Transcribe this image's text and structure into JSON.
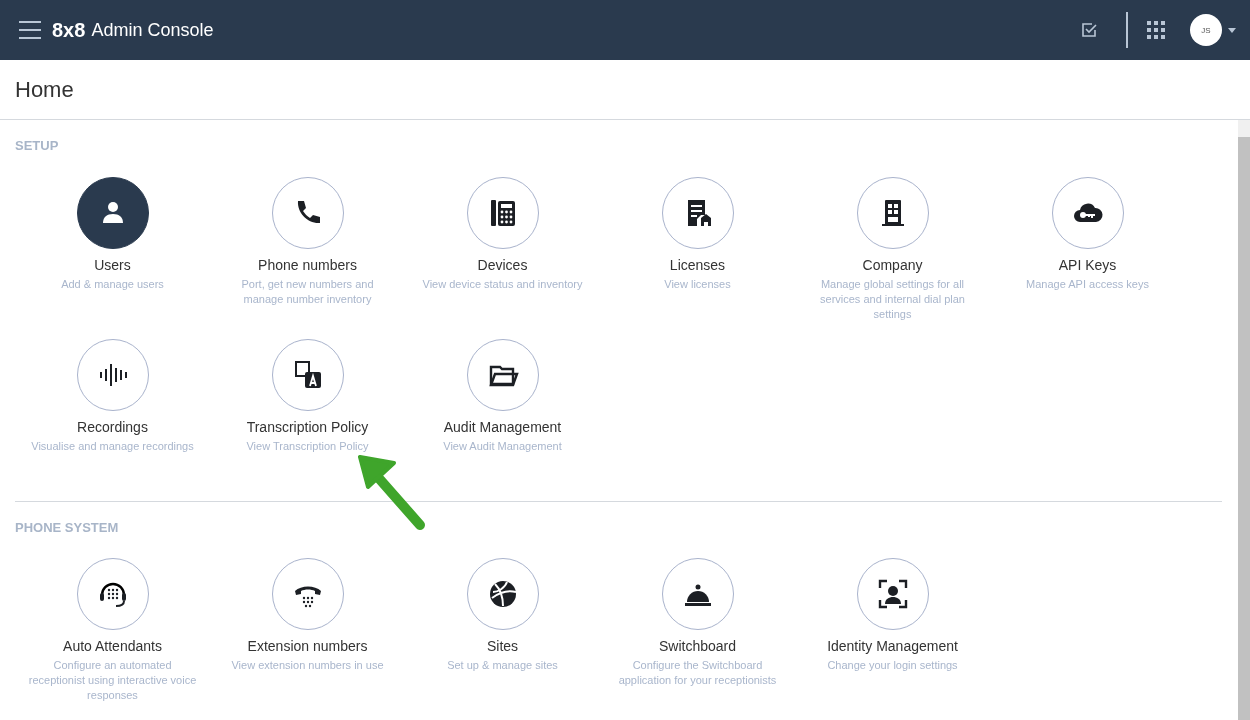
{
  "header": {
    "logo": "8x8",
    "title": "Admin Console",
    "avatar": "JS"
  },
  "page": {
    "title": "Home"
  },
  "sections": [
    {
      "title": "SETUP",
      "tiles": [
        {
          "title": "Users",
          "description": "Add & manage users",
          "selected": true
        },
        {
          "title": "Phone numbers",
          "description": "Port, get new numbers and manage number inventory",
          "selected": false
        },
        {
          "title": "Devices",
          "description": "View device status and inventory",
          "selected": false
        },
        {
          "title": "Licenses",
          "description": "View licenses",
          "selected": false
        },
        {
          "title": "Company",
          "description": "Manage global settings for all services and internal dial plan settings",
          "selected": false
        },
        {
          "title": "API Keys",
          "description": "Manage API access keys",
          "selected": false
        },
        {
          "title": "Recordings",
          "description": "Visualise and manage recordings",
          "selected": false
        },
        {
          "title": "Transcription Policy",
          "description": "View Transcription Policy",
          "selected": false
        },
        {
          "title": "Audit Management",
          "description": "View Audit Management",
          "selected": false
        }
      ]
    },
    {
      "title": "PHONE SYSTEM",
      "tiles": [
        {
          "title": "Auto Attendants",
          "description": "Configure an automated receptionist using interactive voice responses",
          "selected": false
        },
        {
          "title": "Extension numbers",
          "description": "View extension numbers in use",
          "selected": false
        },
        {
          "title": "Sites",
          "description": "Set up & manage sites",
          "selected": false
        },
        {
          "title": "Switchboard",
          "description": "Configure the Switchboard application for your receptionists",
          "selected": false
        },
        {
          "title": "Identity Management",
          "description": "Change your login settings",
          "selected": false
        }
      ]
    }
  ]
}
